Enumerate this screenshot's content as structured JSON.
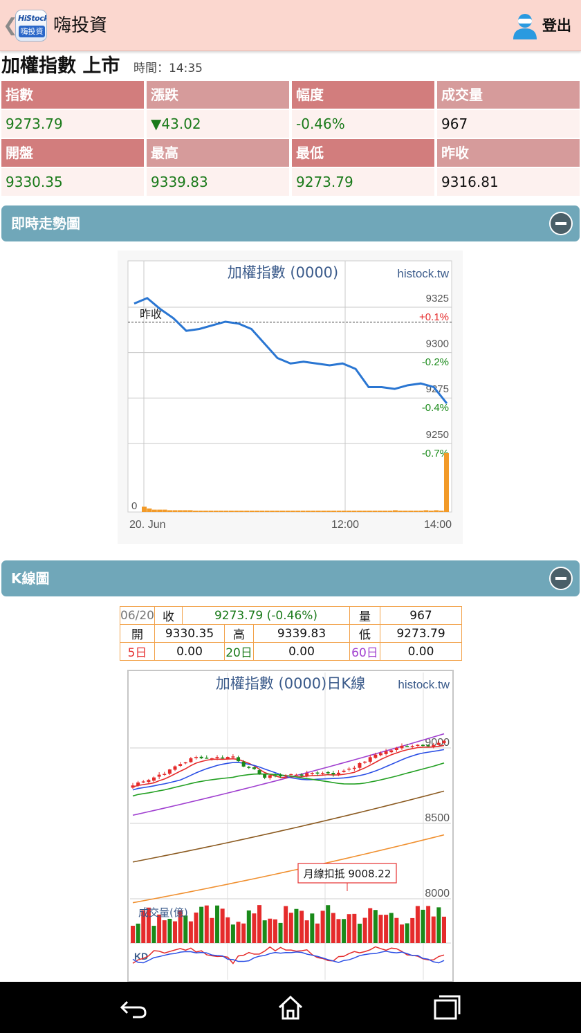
{
  "appbar": {
    "back_icon": "chevron-left-icon",
    "logo_top": "HiStock",
    "logo_bottom": "嗨投資",
    "title": "嗨投資",
    "user_icon": "user-avatar-icon",
    "logout_label": "登出"
  },
  "index": {
    "title": "加權指數 上市",
    "time": "時間：14:35",
    "headers_row1": [
      "指數",
      "漲跌",
      "幅度",
      "成交量"
    ],
    "values_row1": [
      "9273.79",
      "▼43.02",
      "-0.46%",
      "967"
    ],
    "headers_row2": [
      "開盤",
      "最高",
      "最低",
      "昨收"
    ],
    "values_row2": [
      "9330.35",
      "9339.83",
      "9273.79",
      "9316.81"
    ]
  },
  "realtime": {
    "section_label": "即時走勢圖",
    "collapse_icon": "minus-circle-icon"
  },
  "kline": {
    "section_label": "K線圖",
    "collapse_icon": "minus-circle-icon",
    "info": {
      "date": "06/20",
      "close_label": "收",
      "close_value": "9273.79 (-0.46%)",
      "vol_label": "量",
      "vol_value": "967",
      "open_label": "開",
      "open_value": "9330.35",
      "high_label": "高",
      "high_value": "9339.83",
      "low_label": "低",
      "low_value": "9273.79",
      "ma5_label": "5日",
      "ma5_value": "0.00",
      "ma20_label": "20日",
      "ma20_value": "0.00",
      "ma60_label": "60日",
      "ma60_value": "0.00"
    }
  },
  "chart_data": [
    {
      "type": "line",
      "title": "加權指數 (0000)",
      "watermark": "histock.tw",
      "prev_close_label": "昨收",
      "prev_close": 9316.81,
      "x_ticks": [
        "20. Jun",
        "12:00",
        "14:00"
      ],
      "y_ticks": [
        9325,
        9300,
        9275,
        9250
      ],
      "pct_ticks": [
        "+0.1%",
        "-0.2%",
        "-0.4%",
        "-0.7%"
      ],
      "volume_zero_label": "0",
      "series": [
        {
          "values": [
            9327,
            9330,
            9324,
            9319,
            9312,
            9313,
            9315,
            9317,
            9316,
            9313,
            9305,
            9297,
            9294,
            9295,
            9294,
            9293,
            9294,
            9291,
            9281,
            9281,
            9280,
            9282,
            9283,
            9281,
            9272
          ]
        }
      ],
      "volume": [
        9,
        6,
        4,
        4,
        4,
        3,
        3,
        3,
        3,
        3,
        2,
        2,
        2,
        2,
        2,
        2,
        2,
        2,
        2,
        2,
        2,
        2,
        2,
        2,
        2,
        2,
        2,
        2,
        2,
        2,
        2,
        2,
        2,
        2,
        2,
        2,
        2,
        2,
        2,
        2,
        2,
        2,
        2,
        2,
        2,
        2,
        2,
        2,
        2,
        3,
        2,
        2,
        2,
        2,
        2,
        3,
        2,
        3,
        2,
        100
      ],
      "ylim": [
        9240,
        9340
      ]
    },
    {
      "type": "candlestick",
      "title": "加權指數 (0000)日K線",
      "watermark": "histock.tw",
      "y_ticks": [
        9000,
        8500,
        8000
      ],
      "annotation": "月線扣抵 9008.22",
      "volume_label": "成交量(億)",
      "kd_label": "KD",
      "ylim": [
        7950,
        9400
      ],
      "ma_colors": {
        "ma5": "#e52b2b",
        "ma10": "#2b4fe5",
        "ma20": "#23a023",
        "ma60": "#a040d0",
        "ma120": "#8b5a20",
        "ma240": "#f09030"
      }
    }
  ],
  "navbar": {
    "back_icon": "back-arrow-icon",
    "home_icon": "home-icon",
    "recents_icon": "recent-apps-icon"
  }
}
